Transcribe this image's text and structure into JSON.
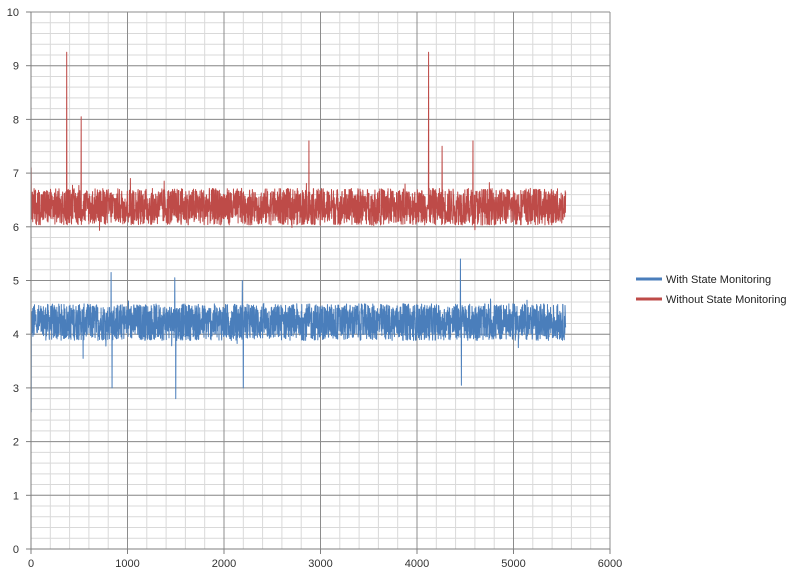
{
  "chart_data": {
    "type": "line",
    "title": "",
    "xlabel": "",
    "ylabel": "",
    "xlim": [
      0,
      6000
    ],
    "ylim": [
      0,
      10
    ],
    "x_ticks": [
      0,
      1000,
      2000,
      3000,
      4000,
      5000,
      6000
    ],
    "y_ticks": [
      0,
      1,
      2,
      3,
      4,
      5,
      6,
      7,
      8,
      9,
      10
    ],
    "x_tick_labels": [
      "0",
      "1000",
      "2000",
      "3000",
      "4000",
      "5000",
      "6000"
    ],
    "y_tick_labels": [
      "0",
      "1",
      "2",
      "3",
      "4",
      "5",
      "6",
      "7",
      "8",
      "9",
      "10"
    ],
    "grid": {
      "major": true,
      "minor_x_step": 200,
      "minor_y_step": 0.2
    },
    "legend": "right",
    "x_range": [
      0,
      5540
    ],
    "series": [
      {
        "name": "With State Monitoring",
        "color": "#4a7ebb",
        "band": [
          3.9,
          4.55
        ],
        "spikes": [
          {
            "x": 1,
            "y": 2.55
          },
          {
            "x": 830,
            "y": 5.15
          },
          {
            "x": 840,
            "y": 3.0
          },
          {
            "x": 540,
            "y": 3.55
          },
          {
            "x": 1490,
            "y": 5.05
          },
          {
            "x": 1500,
            "y": 2.8
          },
          {
            "x": 2190,
            "y": 5.0
          },
          {
            "x": 2200,
            "y": 3.0
          },
          {
            "x": 4450,
            "y": 5.4
          },
          {
            "x": 4460,
            "y": 3.05
          },
          {
            "x": 5050,
            "y": 3.75
          }
        ]
      },
      {
        "name": "Without State Monitoring",
        "color": "#be4b48",
        "band": [
          6.05,
          6.7
        ],
        "spikes": [
          {
            "x": 1,
            "y": 7.1
          },
          {
            "x": 370,
            "y": 9.25
          },
          {
            "x": 520,
            "y": 8.05
          },
          {
            "x": 1030,
            "y": 6.9
          },
          {
            "x": 1380,
            "y": 6.85
          },
          {
            "x": 2880,
            "y": 7.6
          },
          {
            "x": 4120,
            "y": 9.25
          },
          {
            "x": 4260,
            "y": 7.5
          },
          {
            "x": 4580,
            "y": 7.6
          }
        ]
      }
    ]
  }
}
